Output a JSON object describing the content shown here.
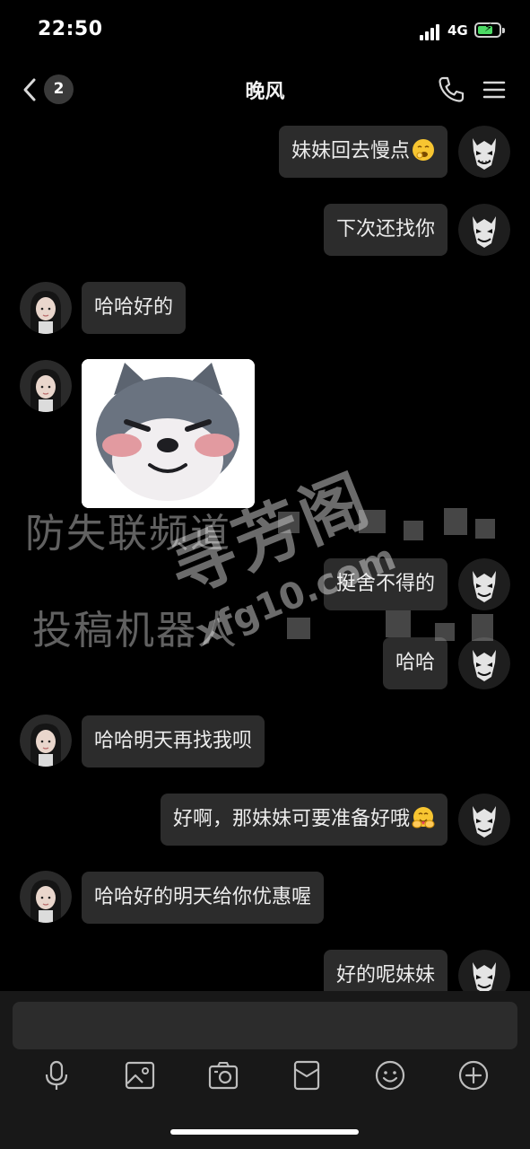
{
  "status_bar": {
    "time": "22:50",
    "network": "4G"
  },
  "nav": {
    "unread_count": "2",
    "title": "晚风"
  },
  "messages": [
    {
      "side": "right",
      "text": "妹妹回去慢点",
      "emoji": "yawning-face-icon"
    },
    {
      "side": "right",
      "text": "下次还找你"
    },
    {
      "side": "left",
      "text": "哈哈好的"
    },
    {
      "side": "left",
      "type": "sticker",
      "sticker": "husky-dog-sticker"
    },
    {
      "side": "right",
      "text": "挺舍不得的"
    },
    {
      "side": "right",
      "text": "哈哈"
    },
    {
      "side": "left",
      "text": "哈哈明天再找我呗"
    },
    {
      "side": "right",
      "text": "好啊，那妹妹可要准备好哦",
      "emoji": "hug-face-icon"
    },
    {
      "side": "left",
      "text": "哈哈好的明天给你优惠喔"
    },
    {
      "side": "right",
      "text": "好的呢妹妹"
    }
  ],
  "watermark": {
    "line1": "防失联频道",
    "line2": "投稿机器人",
    "brand": "寻芳阁",
    "url": "xfg10.com"
  },
  "input": {
    "value": ""
  },
  "toolbar": [
    "microphone-icon",
    "image-icon",
    "camera-icon",
    "red-packet-icon",
    "emoji-icon",
    "add-icon"
  ],
  "colors": {
    "background": "#000000",
    "bubble": "#2c2c2c",
    "input_bar": "#181818"
  }
}
